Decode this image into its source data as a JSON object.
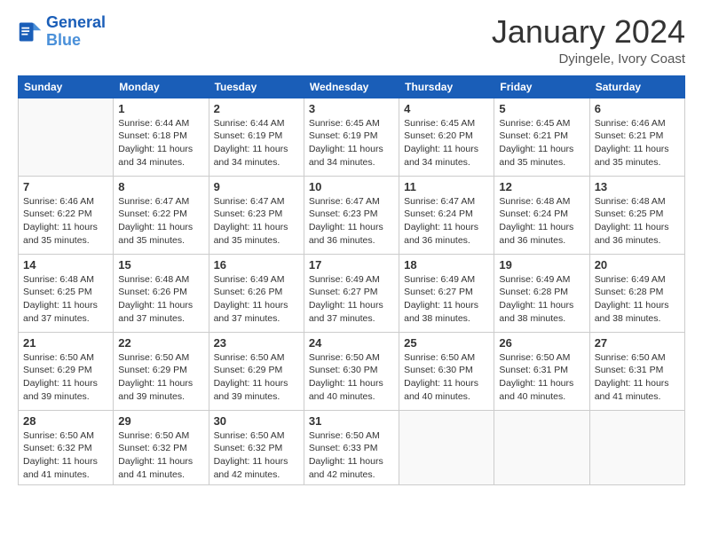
{
  "logo": {
    "line1": "General",
    "line2": "Blue"
  },
  "title": "January 2024",
  "location": "Dyingele, Ivory Coast",
  "days_header": [
    "Sunday",
    "Monday",
    "Tuesday",
    "Wednesday",
    "Thursday",
    "Friday",
    "Saturday"
  ],
  "weeks": [
    [
      {
        "num": "",
        "info": ""
      },
      {
        "num": "1",
        "info": "Sunrise: 6:44 AM\nSunset: 6:18 PM\nDaylight: 11 hours\nand 34 minutes."
      },
      {
        "num": "2",
        "info": "Sunrise: 6:44 AM\nSunset: 6:19 PM\nDaylight: 11 hours\nand 34 minutes."
      },
      {
        "num": "3",
        "info": "Sunrise: 6:45 AM\nSunset: 6:19 PM\nDaylight: 11 hours\nand 34 minutes."
      },
      {
        "num": "4",
        "info": "Sunrise: 6:45 AM\nSunset: 6:20 PM\nDaylight: 11 hours\nand 34 minutes."
      },
      {
        "num": "5",
        "info": "Sunrise: 6:45 AM\nSunset: 6:21 PM\nDaylight: 11 hours\nand 35 minutes."
      },
      {
        "num": "6",
        "info": "Sunrise: 6:46 AM\nSunset: 6:21 PM\nDaylight: 11 hours\nand 35 minutes."
      }
    ],
    [
      {
        "num": "7",
        "info": "Sunrise: 6:46 AM\nSunset: 6:22 PM\nDaylight: 11 hours\nand 35 minutes."
      },
      {
        "num": "8",
        "info": "Sunrise: 6:47 AM\nSunset: 6:22 PM\nDaylight: 11 hours\nand 35 minutes."
      },
      {
        "num": "9",
        "info": "Sunrise: 6:47 AM\nSunset: 6:23 PM\nDaylight: 11 hours\nand 35 minutes."
      },
      {
        "num": "10",
        "info": "Sunrise: 6:47 AM\nSunset: 6:23 PM\nDaylight: 11 hours\nand 36 minutes."
      },
      {
        "num": "11",
        "info": "Sunrise: 6:47 AM\nSunset: 6:24 PM\nDaylight: 11 hours\nand 36 minutes."
      },
      {
        "num": "12",
        "info": "Sunrise: 6:48 AM\nSunset: 6:24 PM\nDaylight: 11 hours\nand 36 minutes."
      },
      {
        "num": "13",
        "info": "Sunrise: 6:48 AM\nSunset: 6:25 PM\nDaylight: 11 hours\nand 36 minutes."
      }
    ],
    [
      {
        "num": "14",
        "info": "Sunrise: 6:48 AM\nSunset: 6:25 PM\nDaylight: 11 hours\nand 37 minutes."
      },
      {
        "num": "15",
        "info": "Sunrise: 6:48 AM\nSunset: 6:26 PM\nDaylight: 11 hours\nand 37 minutes."
      },
      {
        "num": "16",
        "info": "Sunrise: 6:49 AM\nSunset: 6:26 PM\nDaylight: 11 hours\nand 37 minutes."
      },
      {
        "num": "17",
        "info": "Sunrise: 6:49 AM\nSunset: 6:27 PM\nDaylight: 11 hours\nand 37 minutes."
      },
      {
        "num": "18",
        "info": "Sunrise: 6:49 AM\nSunset: 6:27 PM\nDaylight: 11 hours\nand 38 minutes."
      },
      {
        "num": "19",
        "info": "Sunrise: 6:49 AM\nSunset: 6:28 PM\nDaylight: 11 hours\nand 38 minutes."
      },
      {
        "num": "20",
        "info": "Sunrise: 6:49 AM\nSunset: 6:28 PM\nDaylight: 11 hours\nand 38 minutes."
      }
    ],
    [
      {
        "num": "21",
        "info": "Sunrise: 6:50 AM\nSunset: 6:29 PM\nDaylight: 11 hours\nand 39 minutes."
      },
      {
        "num": "22",
        "info": "Sunrise: 6:50 AM\nSunset: 6:29 PM\nDaylight: 11 hours\nand 39 minutes."
      },
      {
        "num": "23",
        "info": "Sunrise: 6:50 AM\nSunset: 6:29 PM\nDaylight: 11 hours\nand 39 minutes."
      },
      {
        "num": "24",
        "info": "Sunrise: 6:50 AM\nSunset: 6:30 PM\nDaylight: 11 hours\nand 40 minutes."
      },
      {
        "num": "25",
        "info": "Sunrise: 6:50 AM\nSunset: 6:30 PM\nDaylight: 11 hours\nand 40 minutes."
      },
      {
        "num": "26",
        "info": "Sunrise: 6:50 AM\nSunset: 6:31 PM\nDaylight: 11 hours\nand 40 minutes."
      },
      {
        "num": "27",
        "info": "Sunrise: 6:50 AM\nSunset: 6:31 PM\nDaylight: 11 hours\nand 41 minutes."
      }
    ],
    [
      {
        "num": "28",
        "info": "Sunrise: 6:50 AM\nSunset: 6:32 PM\nDaylight: 11 hours\nand 41 minutes."
      },
      {
        "num": "29",
        "info": "Sunrise: 6:50 AM\nSunset: 6:32 PM\nDaylight: 11 hours\nand 41 minutes."
      },
      {
        "num": "30",
        "info": "Sunrise: 6:50 AM\nSunset: 6:32 PM\nDaylight: 11 hours\nand 42 minutes."
      },
      {
        "num": "31",
        "info": "Sunrise: 6:50 AM\nSunset: 6:33 PM\nDaylight: 11 hours\nand 42 minutes."
      },
      {
        "num": "",
        "info": ""
      },
      {
        "num": "",
        "info": ""
      },
      {
        "num": "",
        "info": ""
      }
    ]
  ]
}
